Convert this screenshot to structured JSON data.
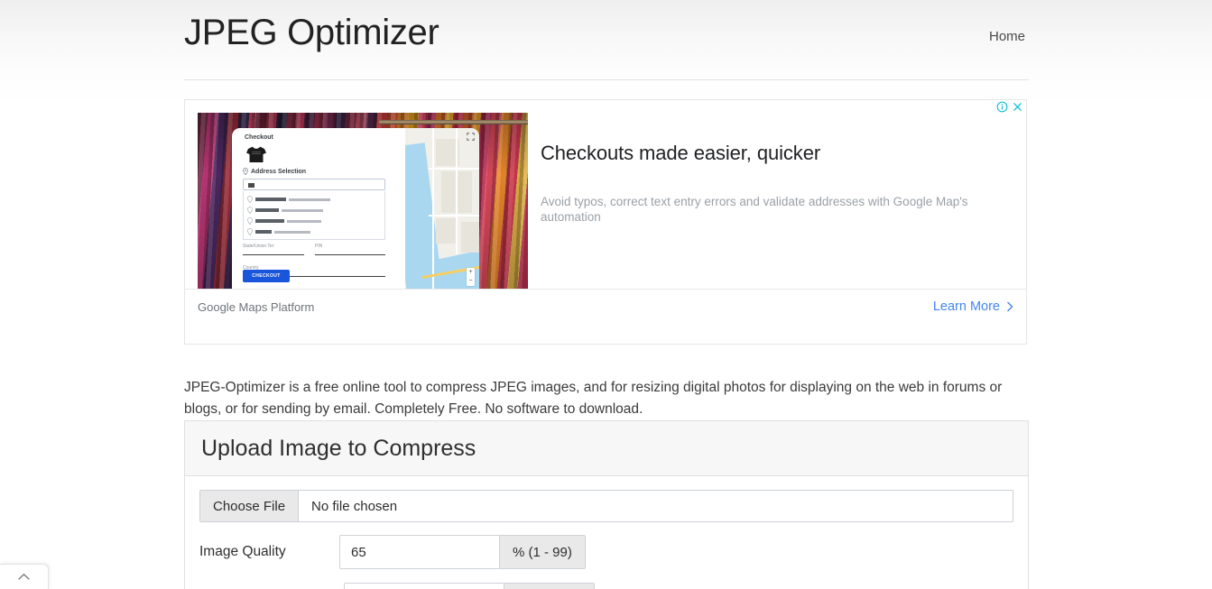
{
  "header": {
    "brand_title": "JPEG Optimizer",
    "nav": [
      {
        "label": "Home",
        "name": "nav-home"
      }
    ]
  },
  "ad": {
    "info_icon": "info-circle-icon",
    "close_icon": "close-icon",
    "headline": "Checkouts made easier, quicker",
    "description": "Avoid typos, correct text entry errors and validate addresses with Google Map's automation",
    "advertiser": "Google Maps Platform",
    "cta_label": "Learn More",
    "cta_icon": "chevron-right-icon",
    "link_color": "#4285f4",
    "control_color": "#00bcd4",
    "creative": {
      "card_title": "Checkout",
      "card_section_label": "Address Selection",
      "card_input_value": "10",
      "card_field_state_city": "State/Union Ter",
      "card_field_pin": "PIN",
      "card_field_country": "Country",
      "card_button_label": "CHECKOUT",
      "map_zoom_in": "+",
      "map_zoom_out": "−"
    }
  },
  "intro": {
    "text": "JPEG-Optimizer is a free online tool to compress JPEG images, and for resizing digital photos for displaying on the web in forums or blogs, or for sending by email. Completely Free. No software to download."
  },
  "upload_panel": {
    "title": "Upload Image to Compress",
    "file_input": {
      "button_label": "Choose File",
      "status_text": "No file chosen"
    },
    "quality": {
      "label": "Image Quality",
      "value": "65",
      "suffix": "% (1 - 99)"
    }
  },
  "scroll_top": {
    "icon": "chevron-up-icon"
  }
}
